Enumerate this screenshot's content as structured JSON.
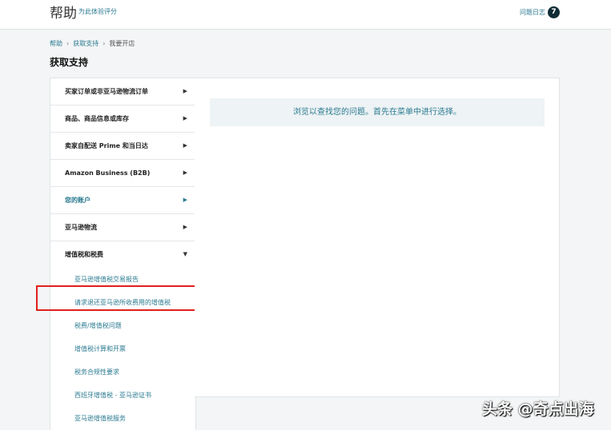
{
  "header": {
    "title": "帮助",
    "subtitle": "为此体验评分",
    "issue_log": "问题日志",
    "issue_count": "7"
  },
  "breadcrumb": [
    "帮助",
    "获取支持",
    "我要开店"
  ],
  "page_title": "获取支持",
  "sidebar": {
    "items": [
      {
        "label": "买家订单或非亚马逊物流订单"
      },
      {
        "label": "商品、商品信息或库存"
      },
      {
        "label": "卖家自配送 Prime 和当日达"
      },
      {
        "label": "Amazon Business (B2B)"
      },
      {
        "label": "您的账户"
      },
      {
        "label": "亚马逊物流"
      },
      {
        "label": "增值税和税费"
      }
    ],
    "subitems": [
      "亚马逊增值税交易报告",
      "请求退还亚马逊所收费用的增值税",
      "税费/增值税问题",
      "增值税计算和开票",
      "税务合规性要求",
      "西班牙增值税 - 亚马逊证书",
      "亚马逊增值税服务"
    ]
  },
  "main": {
    "message": "浏览以查找您的问题。首先在菜单中进行选择。"
  },
  "watermark": "头条 @奇点出海"
}
